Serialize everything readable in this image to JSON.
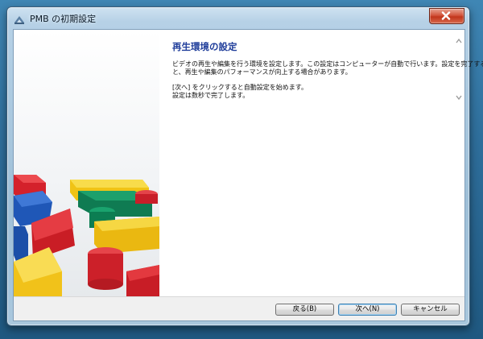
{
  "window": {
    "title": "PMB の初期設定"
  },
  "content": {
    "heading": "再生環境の設定",
    "paragraph1": [
      "ビデオの再生や編集を行う環境を設定します。この設定はコンピューターが自動で行います。設定を完了する",
      "と、再生や編集のパフォーマンスが向上する場合があります。"
    ],
    "paragraph2": [
      "[次へ] をクリックすると自動設定を始めます。",
      "設定は数秒で完了します。"
    ]
  },
  "buttons": {
    "back": "戻る(B)",
    "next": "次へ(N)",
    "cancel": "キャンセル"
  },
  "colors": {
    "heading": "#1f3d9a",
    "desktop": "#2f6f9c",
    "close_button": "#c1351b"
  },
  "icons": {
    "app": "pmb-app-icon",
    "close": "close-icon",
    "scroll_up": "scroll-up-arrow-icon",
    "scroll_down": "scroll-down-arrow-icon"
  }
}
